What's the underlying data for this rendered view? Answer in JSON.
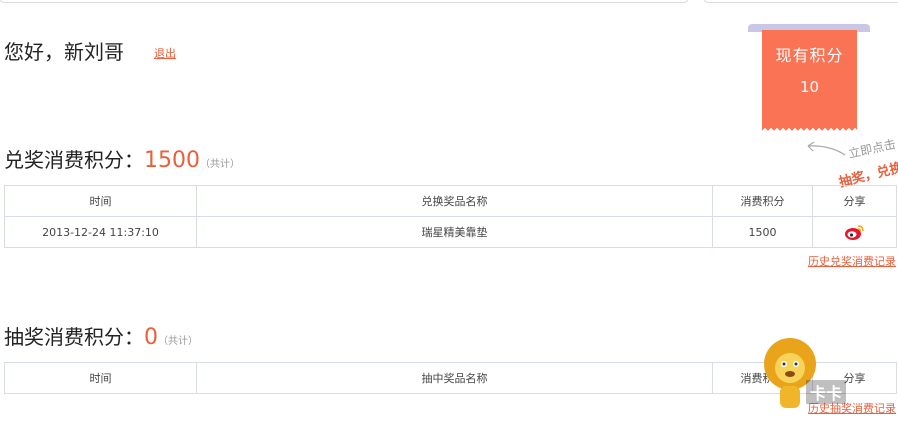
{
  "greeting": "您好，新刘哥",
  "logout_label": "退出",
  "badge": {
    "title": "现有积分",
    "value": "10"
  },
  "hint": {
    "line1": "立即点击",
    "line2": "抽奖，兑换"
  },
  "exchange": {
    "title_prefix": "兑奖消费积分：",
    "total": "1500",
    "total_note": "（共计）",
    "headers": [
      "时间",
      "兑换奖品名称",
      "消费积分",
      "分享"
    ],
    "rows": [
      {
        "time": "2013-12-24 11:37:10",
        "prize": "瑞星精美靠垫",
        "points": "1500",
        "share_icon": "weibo-icon"
      }
    ],
    "history_link": "历史兑奖消费记录"
  },
  "lottery": {
    "title_prefix": "抽奖消费积分：",
    "total": "0",
    "total_note": "（共计）",
    "headers": [
      "时间",
      "抽中奖品名称",
      "消费积分",
      "分享"
    ],
    "history_link": "历史抽奖消费记录"
  },
  "watermark": {
    "text": "卡卡",
    "icon": "lion-mascot-icon"
  },
  "colors": {
    "accent": "#e8603c",
    "badge_bg": "#f97354",
    "border": "#d8dbe8"
  }
}
